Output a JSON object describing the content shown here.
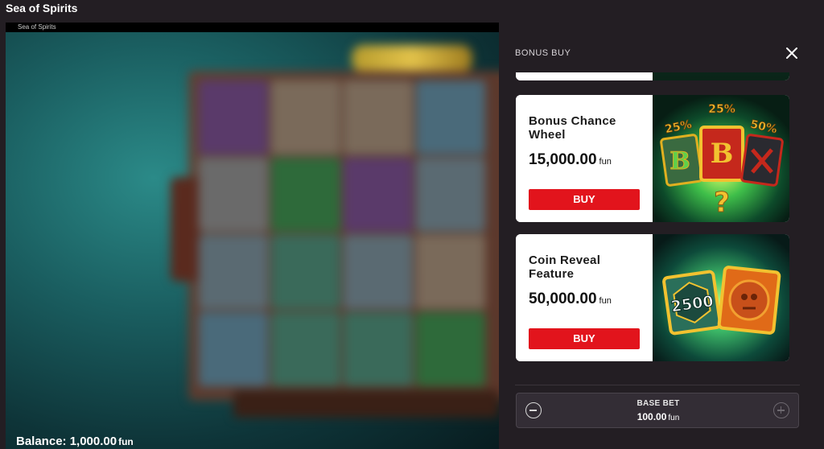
{
  "window": {
    "title": "Sea of Spirits"
  },
  "game": {
    "frame_title": "Sea of Spirits",
    "balance_label": "Balance:",
    "balance_value": "1,000.00",
    "balance_unit": "fun"
  },
  "bonus_panel": {
    "title": "BONUS BUY",
    "close_icon": "close-icon",
    "cards": [
      {
        "name": "Bonus Chance Wheel",
        "price": "15,000.00",
        "unit": "fun",
        "buy_label": "BUY",
        "art": {
          "labels": [
            "25%",
            "25%",
            "50%"
          ],
          "colors": [
            "#3aa03c",
            "#e0b020",
            "#c5281c"
          ]
        }
      },
      {
        "name": "Coin Reveal Feature",
        "price": "50,000.00",
        "unit": "fun",
        "buy_label": "BUY",
        "art": {
          "labels": [
            "2500"
          ],
          "colors": [
            "#2a6f5a",
            "#e06a18"
          ]
        }
      }
    ],
    "base_bet": {
      "label": "BASE BET",
      "value": "100.00",
      "unit": "fun"
    }
  },
  "colors": {
    "buy_button": "#e2141c",
    "panel_bg": "#231e23"
  }
}
